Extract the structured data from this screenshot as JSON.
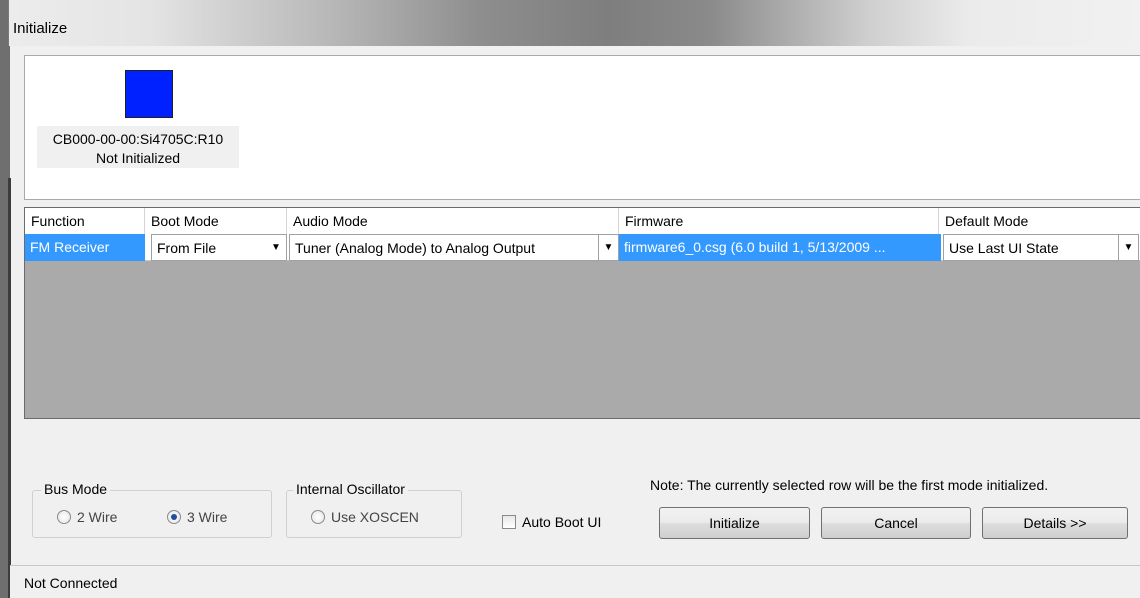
{
  "window": {
    "title": "Initialize"
  },
  "device": {
    "name": "CB000-00-00:Si4705C:R10",
    "status": "Not Initialized",
    "color": "#0021ff"
  },
  "grid": {
    "columns": [
      "Function",
      "Boot Mode",
      "Audio Mode",
      "Firmware",
      "Default Mode"
    ],
    "rows": [
      {
        "function": "FM Receiver",
        "boot_mode": "From File",
        "audio_mode": "Tuner (Analog Mode) to Analog Output",
        "firmware": "firmware6_0.csg (6.0 build 1, 5/13/2009 ...",
        "default_mode": "Use Last UI State"
      }
    ]
  },
  "bus_mode": {
    "label": "Bus Mode",
    "options": [
      {
        "label": "2 Wire",
        "selected": false
      },
      {
        "label": "3 Wire",
        "selected": true
      }
    ]
  },
  "oscillator": {
    "label": "Internal Oscillator",
    "option": {
      "label": "Use XOSCEN",
      "selected": false
    }
  },
  "auto_boot": {
    "label": "Auto Boot UI",
    "checked": false
  },
  "note": "Note: The currently selected row will be the first mode initialized.",
  "buttons": {
    "initialize": "Initialize",
    "cancel": "Cancel",
    "details": "Details >>"
  },
  "status": "Not Connected",
  "colors": {
    "selection": "#3399ff",
    "grid_background": "#aaaaaa"
  }
}
